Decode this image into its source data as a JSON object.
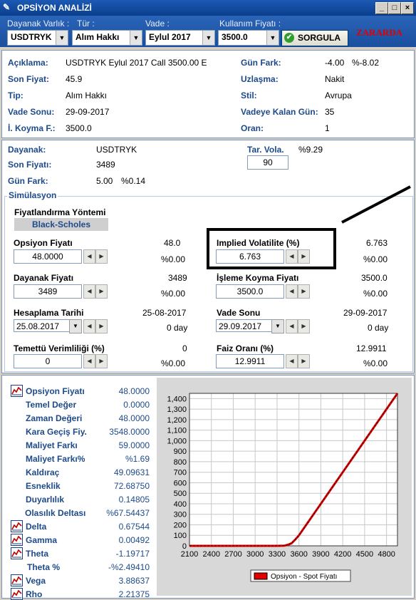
{
  "window": {
    "title": "OPSİYON ANALİZİ",
    "buttons": {
      "minimize": "_",
      "maximize": "□",
      "close": "×"
    }
  },
  "toolbar": {
    "labels": {
      "underlying": "Dayanak Varlık :",
      "type": "Tür :",
      "expiry": "Vade :",
      "strike": "Kullanım Fiyatı :"
    },
    "underlying": "USDTRYK",
    "type": "Alım Hakkı",
    "expiry": "Eylul 2017",
    "strike": "3500.0",
    "query_button": "SORGULA",
    "status": "ZARARDA"
  },
  "info": {
    "labels": {
      "desc": "Açıklama:",
      "last": "Son Fiyat:",
      "type": "Tip:",
      "expiry": "Vade Sonu:",
      "strike": "İ. Koyma F.:",
      "daychange": "Gün Fark:",
      "settle": "Uzlaşma:",
      "style": "Stil:",
      "days_left": "Vadeye Kalan Gün:",
      "ratio": "Oran:"
    },
    "desc": "USDTRYK Eylul 2017 Call 3500.00 E",
    "last": "45.9",
    "type": "Alım Hakkı",
    "expiry": "29-09-2017",
    "strike": "3500.0",
    "daychange": "-4.00",
    "daychange_pct": "%-8.02",
    "settle": "Nakit",
    "style": "Avrupa",
    "days_left": "35",
    "ratio": "1"
  },
  "underlying": {
    "labels": {
      "name": "Dayanak:",
      "last": "Son Fiyatı:",
      "change": "Gün Fark:",
      "hist_vol": "Tar. Vola."
    },
    "name": "USDTRYK",
    "last": "3489",
    "change": "5.00",
    "change_pct": "%0.14",
    "hist_vol": "%9.29",
    "hist_vol_input": "90"
  },
  "simulation": {
    "title": "Simülasyon",
    "pricing_method_label": "Fiyatlandırma Yöntemi",
    "pricing_method": "Black-Scholes",
    "fields": {
      "option_price": {
        "label": "Opsiyon Fiyatı",
        "ref": "48.0",
        "value": "48.0000",
        "pct": "%0.00"
      },
      "implied_vol": {
        "label": "Implied Volatilite (%)",
        "ref": "6.763",
        "value": "6.763",
        "pct": "%0.00"
      },
      "underlying_price": {
        "label": "Dayanak Fiyatı",
        "ref": "3489",
        "value": "3489",
        "pct": "%0.00"
      },
      "strike_price": {
        "label": "İşleme Koyma Fiyatı",
        "ref": "3500.0",
        "value": "3500.0",
        "pct": "%0.00"
      },
      "calc_date": {
        "label": "Hesaplama Tarihi",
        "ref": "25-08-2017",
        "value": "25.08.2017",
        "pct": "0 day"
      },
      "expiry_date": {
        "label": "Vade Sonu",
        "ref": "29-09-2017",
        "value": "29.09.2017",
        "pct": "0 day"
      },
      "dividend": {
        "label": "Temettü Verimliliği (%)",
        "ref": "0",
        "value": "0",
        "pct": "%0.00"
      },
      "interest": {
        "label": "Faiz Oranı (%)",
        "ref": "12.9911",
        "value": "12.9911",
        "pct": "%0.00"
      }
    },
    "spin_icons": {
      "left": "◀",
      "right": "▶",
      "down": "▼"
    }
  },
  "results": [
    {
      "label": "Opsiyon Fiyatı",
      "value": "48.0000",
      "icon": true
    },
    {
      "label": "Temel Değer",
      "value": "0.0000",
      "icon": false
    },
    {
      "label": "Zaman Değeri",
      "value": "48.0000",
      "icon": false
    },
    {
      "label": "Kara Geçiş Fiy.",
      "value": "3548.0000",
      "icon": false
    },
    {
      "label": "Maliyet Farkı",
      "value": "59.0000",
      "icon": false
    },
    {
      "label": "Maliyet Farkı%",
      "value": "%1.69",
      "icon": false
    },
    {
      "label": "Kaldıraç",
      "value": "49.09631",
      "icon": false
    },
    {
      "label": "Esneklik",
      "value": "72.68750",
      "icon": false
    },
    {
      "label": "Duyarlılık",
      "value": "0.14805",
      "icon": false
    },
    {
      "label": "Olasılık Deltası",
      "value": "%67.54437",
      "icon": false
    },
    {
      "label": "Delta",
      "value": "0.67544",
      "icon": true
    },
    {
      "label": "Gamma",
      "value": "0.00492",
      "icon": true
    },
    {
      "label": "Theta",
      "value": "-1.19717",
      "icon": true
    },
    {
      "label": "Theta %",
      "value": "-%2.49410",
      "icon": false
    },
    {
      "label": "Vega",
      "value": "3.88637",
      "icon": true
    },
    {
      "label": "Rho",
      "value": "2.21375",
      "icon": true
    }
  ],
  "chart_data": {
    "type": "line",
    "x_ticks": [
      "2100",
      "2400",
      "2700",
      "3000",
      "3300",
      "3600",
      "3900",
      "4200",
      "4500",
      "4800"
    ],
    "y_ticks": [
      "0",
      "100",
      "200",
      "300",
      "400",
      "500",
      "600",
      "700",
      "800",
      "900",
      "1,000",
      "1,100",
      "1,200",
      "1,300",
      "1,400"
    ],
    "xlim": [
      2100,
      4950
    ],
    "ylim": [
      0,
      1450
    ],
    "series": [
      {
        "name": "Opsiyon - Spot Fiyatı",
        "color": "#e00000",
        "x": [
          2100,
          3300,
          3400,
          3450,
          3500,
          3550,
          3600,
          4950
        ],
        "y": [
          0,
          0,
          2,
          10,
          25,
          60,
          100,
          1450
        ]
      }
    ],
    "grid": true,
    "legend_position": "bottom"
  }
}
